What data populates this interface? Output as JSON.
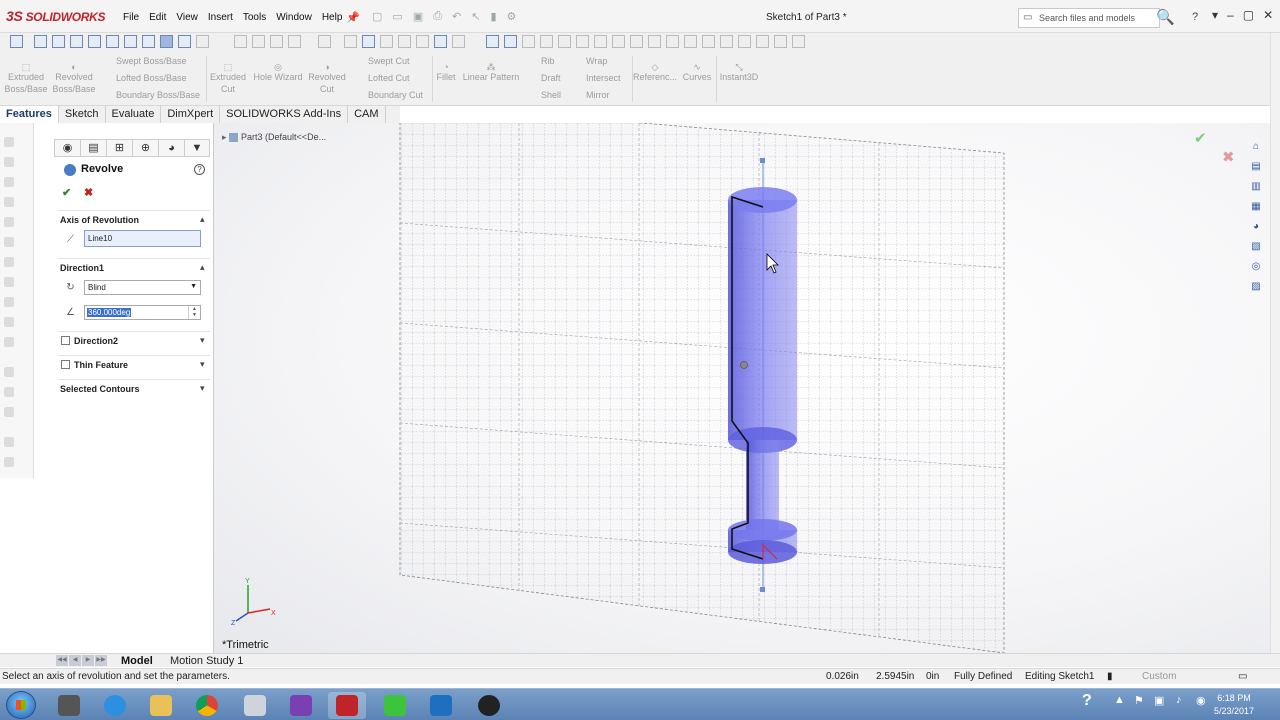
{
  "app": {
    "logo": "SOLIDWORKS",
    "menu": [
      "File",
      "Edit",
      "View",
      "Insert",
      "Tools",
      "Window",
      "Help"
    ],
    "doc_title": "Sketch1 of Part3 *",
    "search_placeholder": "Search files and models",
    "help_label": "?"
  },
  "command_manager": {
    "col1": [
      {
        "line1": "Extruded",
        "line2": "Boss/Base"
      },
      {
        "line1": "Revolved",
        "line2": "Boss/Base"
      }
    ],
    "col2": [
      "Swept Boss/Base",
      "Lofted Boss/Base",
      "Boundary Boss/Base"
    ],
    "col3": [
      {
        "line1": "Extruded",
        "line2": "Cut"
      },
      {
        "line1": "Hole Wizard",
        "line2": ""
      },
      {
        "line1": "Revolved",
        "line2": "Cut"
      }
    ],
    "col4": [
      "Swept Cut",
      "Lofted Cut",
      "Boundary Cut"
    ],
    "col5": [
      "Fillet",
      "Linear Pattern"
    ],
    "col6": [
      "Rib",
      "Draft",
      "Shell"
    ],
    "col7": [
      "Wrap",
      "Intersect",
      "Mirror"
    ],
    "col8": [
      "Referenc...",
      "Curves"
    ],
    "col9": "Instant3D"
  },
  "tabs": [
    "Features",
    "Sketch",
    "Evaluate",
    "DimXpert",
    "SOLIDWORKS Add-Ins",
    "CAM"
  ],
  "property_manager": {
    "title": "Revolve",
    "axis_header": "Axis of Revolution",
    "axis_value": "Line10",
    "direction1_header": "Direction1",
    "end_condition": "Blind",
    "angle": "360.000deg",
    "direction2_header": "Direction2",
    "thin_feature_header": "Thin Feature",
    "selected_contours_header": "Selected Contours"
  },
  "viewport": {
    "tree_label": "Part3  (Default<<De...",
    "view_name": "*Trimetric"
  },
  "bottom_tabs": [
    "Model",
    "Motion Study 1"
  ],
  "status": {
    "message": "Select an axis of revolution and set the parameters.",
    "x": "0.026in",
    "y": "2.5945in",
    "z": "0in",
    "definition": "Fully Defined",
    "editing": "Editing Sketch1",
    "units": "Custom"
  },
  "taskbar": {
    "time": "6:18 PM",
    "date": "5/23/2017"
  },
  "colors": {
    "feature_tab_active": "#1a3c6a",
    "solid_fill": "#6c6ee6",
    "accept": "#2a8a2a",
    "cancel": "#c02020"
  }
}
